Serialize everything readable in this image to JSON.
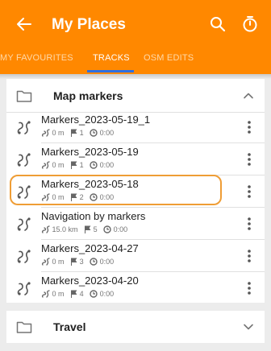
{
  "header": {
    "title": "My Places",
    "back_icon": "arrow-back-icon",
    "search_icon": "search-icon",
    "timer_icon": "timer-icon"
  },
  "tabs": [
    {
      "label": "MY FAVOURITES",
      "active": false
    },
    {
      "label": "TRACKS",
      "active": true
    },
    {
      "label": "OSM EDITS",
      "active": false
    }
  ],
  "groups": [
    {
      "label": "Map markers",
      "expanded": true,
      "icon": "folder-icon"
    },
    {
      "label": "Travel",
      "expanded": false,
      "icon": "folder-icon"
    }
  ],
  "tracks": [
    {
      "name": "Markers_2023-05-19_1",
      "distance": "0 m",
      "points": "1",
      "time": "0:00",
      "highlighted": false
    },
    {
      "name": "Markers_2023-05-19",
      "distance": "0 m",
      "points": "1",
      "time": "0:00",
      "highlighted": false
    },
    {
      "name": "Markers_2023-05-18",
      "distance": "0 m",
      "points": "2",
      "time": "0:00",
      "highlighted": true
    },
    {
      "name": "Navigation by markers",
      "distance": "15.0 km",
      "points": "5",
      "time": "0:00",
      "highlighted": false
    },
    {
      "name": "Markers_2023-04-27",
      "distance": "0 m",
      "points": "3",
      "time": "0:00",
      "highlighted": false
    },
    {
      "name": "Markers_2023-04-20",
      "distance": "0 m",
      "points": "4",
      "time": "0:00",
      "highlighted": false
    }
  ],
  "colors": {
    "accent": "#ff8800",
    "tab_indicator": "#2f6fe0",
    "highlight": "#ef9d35"
  }
}
